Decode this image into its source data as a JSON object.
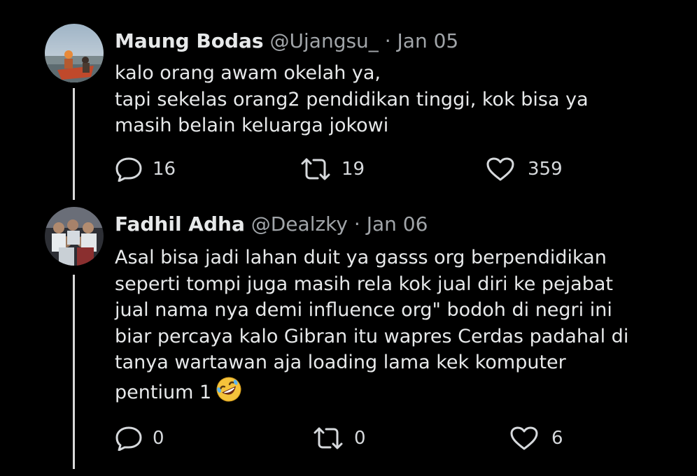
{
  "tweets": [
    {
      "display_name": "Maung Bodas",
      "handle": "@Ujangsu_",
      "separator": "·",
      "date": "Jan 05",
      "lines": [
        "kalo orang awam okelah ya,",
        "tapi sekelas orang2 pendidikan tinggi, kok bisa ya",
        "masih belain keluarga jokowi"
      ],
      "replies": "16",
      "retweets": "19",
      "likes": "359"
    },
    {
      "display_name": "Fadhil Adha",
      "handle": "@Dealzky",
      "separator": "·",
      "date": "Jan 06",
      "lines": [
        "Asal bisa jadi lahan duit ya gasss org berpendidikan",
        "seperti tompi juga masih rela kok jual diri ke pejabat",
        "jual nama nya demi influence org\" bodoh di negri ini",
        "biar percaya kalo Gibran itu wapres Cerdas padahal di",
        "tanya wartawan aja loading lama kek komputer",
        "pentium 1"
      ],
      "emoji": "rolling-on-floor-laughing-emoji",
      "replies": "0",
      "retweets": "0",
      "likes": "6"
    }
  ],
  "colors": {
    "background": "#000000",
    "text": "#e7e9ea",
    "secondary": "#a1a5a9",
    "thread_line": "#d9d9d9"
  }
}
